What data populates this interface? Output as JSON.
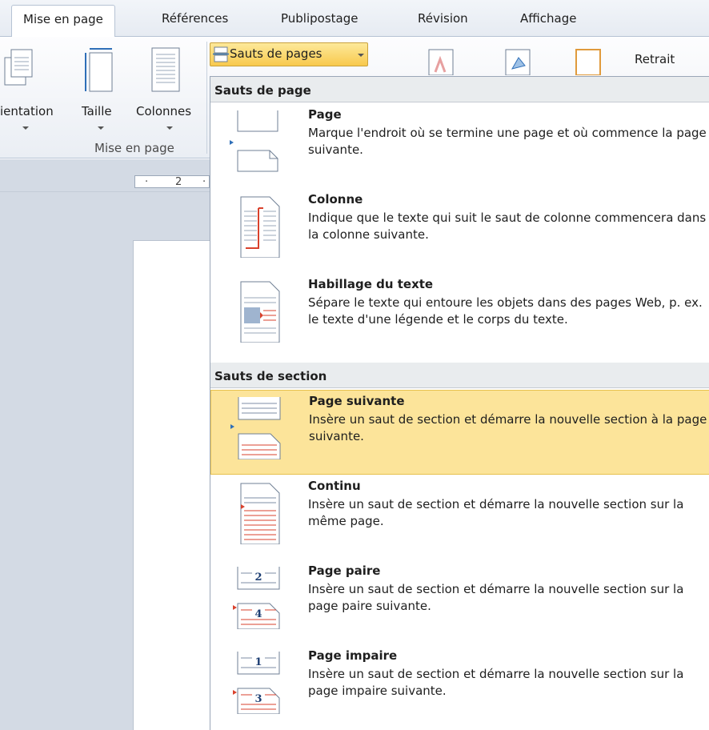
{
  "tabs": [
    "Mise en page",
    "Références",
    "Publipostage",
    "Révision",
    "Affichage"
  ],
  "ribbon": {
    "orientation_label": "ientation",
    "size_label": "Taille",
    "columns_label": "Colonnes",
    "group_label": "Mise en page",
    "breaks_button": "Sauts de pages",
    "indent_label": "Retrait"
  },
  "ruler": {
    "mark": "2"
  },
  "menu": {
    "page_breaks_header": "Sauts de page",
    "section_breaks_header": "Sauts de section",
    "items": [
      {
        "title": "Page",
        "desc": "Marque l'endroit où se termine une page et où commence la page suivante.",
        "icon": "page-break-icon"
      },
      {
        "title": "Colonne",
        "desc": "Indique que le texte qui suit le saut de colonne commencera dans la colonne suivante.",
        "icon": "column-break-icon"
      },
      {
        "title": "Habillage du texte",
        "desc": "Sépare le texte qui entoure les objets dans des pages Web, p. ex. le texte d'une légende et le corps du texte.",
        "icon": "text-wrapping-icon"
      },
      {
        "title": "Page suivante",
        "desc": "Insère un saut de section et démarre la nouvelle section à la page suivante.",
        "icon": "next-page-section-icon"
      },
      {
        "title": "Continu",
        "desc": "Insère un saut de section et démarre la nouvelle section sur la même page.",
        "icon": "continuous-section-icon"
      },
      {
        "title": "Page paire",
        "desc": "Insère un saut de section et démarre la nouvelle section sur la page paire suivante.",
        "icon": "even-page-section-icon",
        "top_num": "2",
        "bottom_num": "4"
      },
      {
        "title": "Page impaire",
        "desc": "Insère un saut de section et démarre la nouvelle section sur la page impaire suivante.",
        "icon": "odd-page-section-icon",
        "top_num": "1",
        "bottom_num": "3"
      }
    ]
  },
  "colors": {
    "highlight": "#fce49a",
    "accent_red": "#d9412c",
    "accent_blue": "#2f6fb8"
  }
}
